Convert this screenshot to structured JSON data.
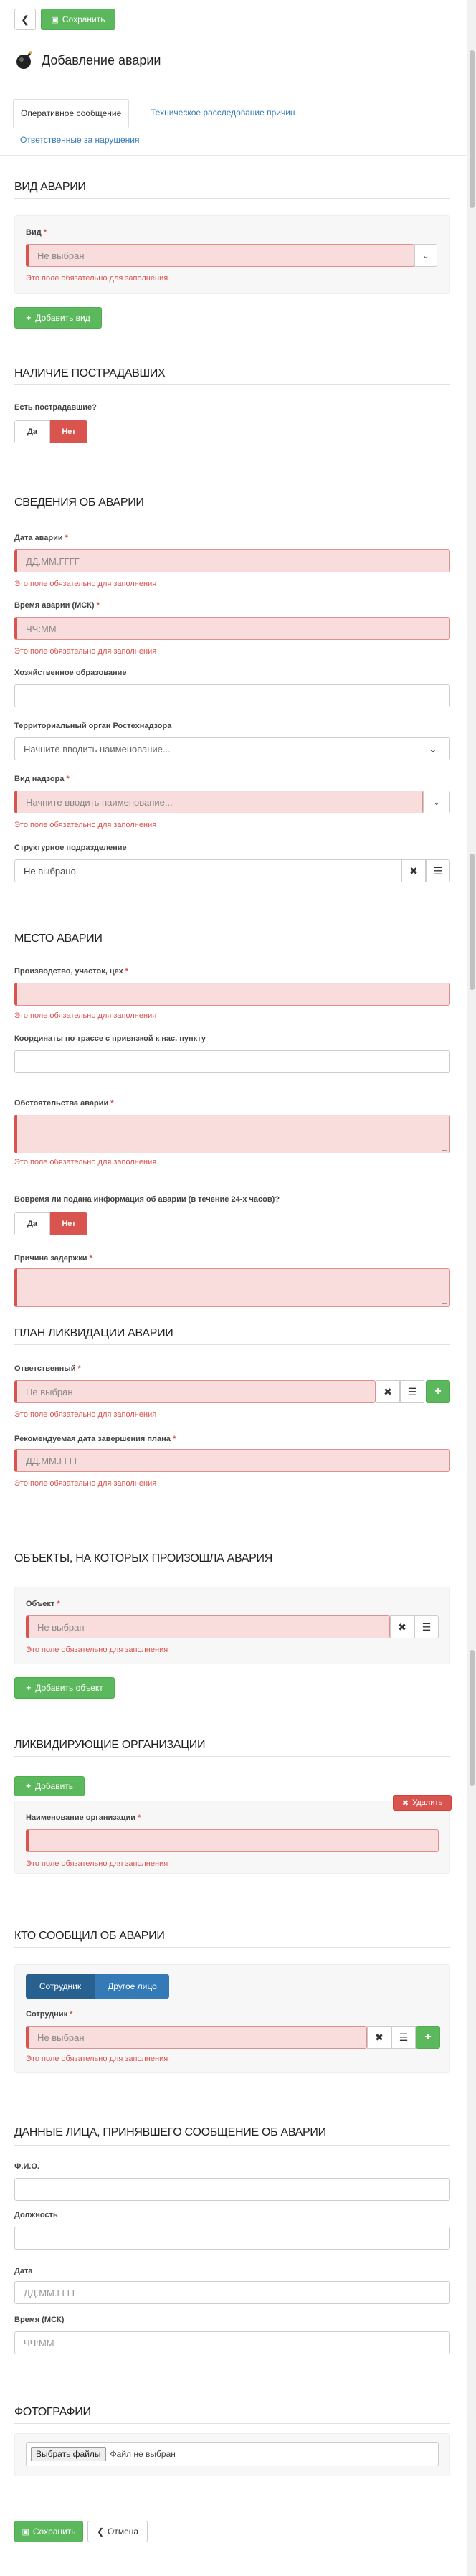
{
  "toolbar": {
    "back_icon": "arrow-left-icon",
    "save_label": "Сохранить"
  },
  "header": {
    "title": "Добавление аварии",
    "logo_icon": "bomb-icon"
  },
  "tabs": [
    {
      "label": "Оперативное сообщение",
      "active": true
    },
    {
      "label": "Техническое расследование причин",
      "active": false
    },
    {
      "label": "Ответственные за нарушения",
      "active": false
    }
  ],
  "messages": {
    "required": "Это поле обязательно для заполнения"
  },
  "sections": {
    "type": {
      "title": "ВИД АВАРИИ",
      "field_label": "Вид",
      "field_value": "Не выбран",
      "add_button": "Добавить вид"
    },
    "victims": {
      "title": "НАЛИЧИЕ ПОСТРАДАВШИХ",
      "question": "Есть пострадавшие?",
      "yes": "Да",
      "no": "Нет"
    },
    "info": {
      "title": "СВЕДЕНИЯ ОБ АВАРИИ",
      "date_label": "Дата аварии",
      "date_placeholder": "ДД.ММ.ГГГГ",
      "time_label": "Время аварии (МСК)",
      "time_placeholder": "ЧЧ:ММ",
      "entity_label": "Хозяйственное образование",
      "authority_label": "Территориальный орган Ростехнадзора",
      "authority_placeholder": "Начните вводить наименование...",
      "supervision_label": "Вид надзора",
      "supervision_placeholder": "Начните вводить наименование...",
      "division_label": "Структурное подразделение",
      "division_value": "Не выбрано"
    },
    "place": {
      "title": "МЕСТО АВАРИИ",
      "production_label": "Производство, участок, цех",
      "coords_label": "Координаты по трассе с привязкой к нас. пункту",
      "circumstances_label": "Обстоятельства аварии",
      "timely_label": "Вовремя ли подана информация об аварии (в течение 24-х часов)?",
      "yes": "Да",
      "no": "Нет",
      "delay_label": "Причина задержки"
    },
    "plan": {
      "title": "ПЛАН ЛИКВИДАЦИИ АВАРИИ",
      "responsible_label": "Ответственный",
      "responsible_value": "Не выбран",
      "due_label": "Рекомендуемая дата завершения плана",
      "due_placeholder": "ДД.ММ.ГГГГ"
    },
    "objects": {
      "title": "ОБЪЕКТЫ, НА КОТОРЫХ ПРОИЗОШЛА АВАРИЯ",
      "object_label": "Объект",
      "object_value": "Не выбран",
      "add_button": "Добавить объект"
    },
    "orgs": {
      "title": "ЛИКВИДИРУЮЩИЕ ОРГАНИЗАЦИИ",
      "add_button": "Добавить",
      "delete_button": "Удалить",
      "name_label": "Наименование организации"
    },
    "reporter": {
      "title": "КТО СООБЩИЛ ОБ АВАРИИ",
      "employee": "Сотрудник",
      "other": "Другое лицо",
      "employee_label": "Сотрудник",
      "employee_value": "Не выбран"
    },
    "receiver": {
      "title": "ДАННЫЕ ЛИЦА, ПРИНЯВШЕГО СООБЩЕНИЕ ОБ АВАРИИ",
      "fio_label": "Ф.И.О.",
      "position_label": "Должность",
      "date_label": "Дата",
      "date_placeholder": "ДД.ММ.ГГГГ",
      "time_label": "Время (МСК)",
      "time_placeholder": "ЧЧ:ММ"
    },
    "photos": {
      "title": "ФОТОГРАФИИ",
      "choose_button": "Выбрать файлы",
      "no_file": "Файл не выбран"
    }
  },
  "footer": {
    "save_label": "Сохранить",
    "cancel_label": "Отмена"
  },
  "colors": {
    "accent_green": "#5cb85c",
    "danger": "#d9534f",
    "link": "#337ab7",
    "primary": "#337ab7"
  }
}
